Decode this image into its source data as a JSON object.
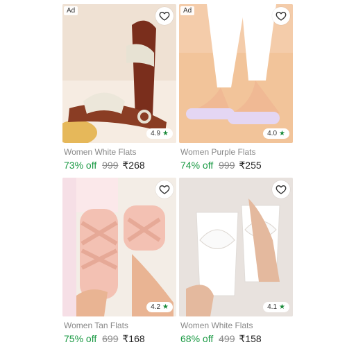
{
  "colors": {
    "discount": "#1b9a44",
    "star": "#1a8a3a",
    "price": "#222222",
    "mrp": "#8a8a8a"
  },
  "products": [
    {
      "ad": "Ad",
      "title": "Women White Flats",
      "rating": "4.9",
      "discount": "73% off",
      "mrp": "999",
      "price": "₹268"
    },
    {
      "ad": "Ad",
      "title": "Women Purple Flats",
      "rating": "4.0",
      "discount": "74% off",
      "mrp": "999",
      "price": "₹255"
    },
    {
      "title": "Women Tan Flats",
      "rating": "4.2",
      "discount": "75% off",
      "mrp": "699",
      "price": "₹168"
    },
    {
      "title": "Women White Flats",
      "rating": "4.1",
      "discount": "68% off",
      "mrp": "499",
      "price": "₹158"
    }
  ],
  "icons": {
    "wishlist": "heart-icon",
    "rating": "star-icon"
  }
}
